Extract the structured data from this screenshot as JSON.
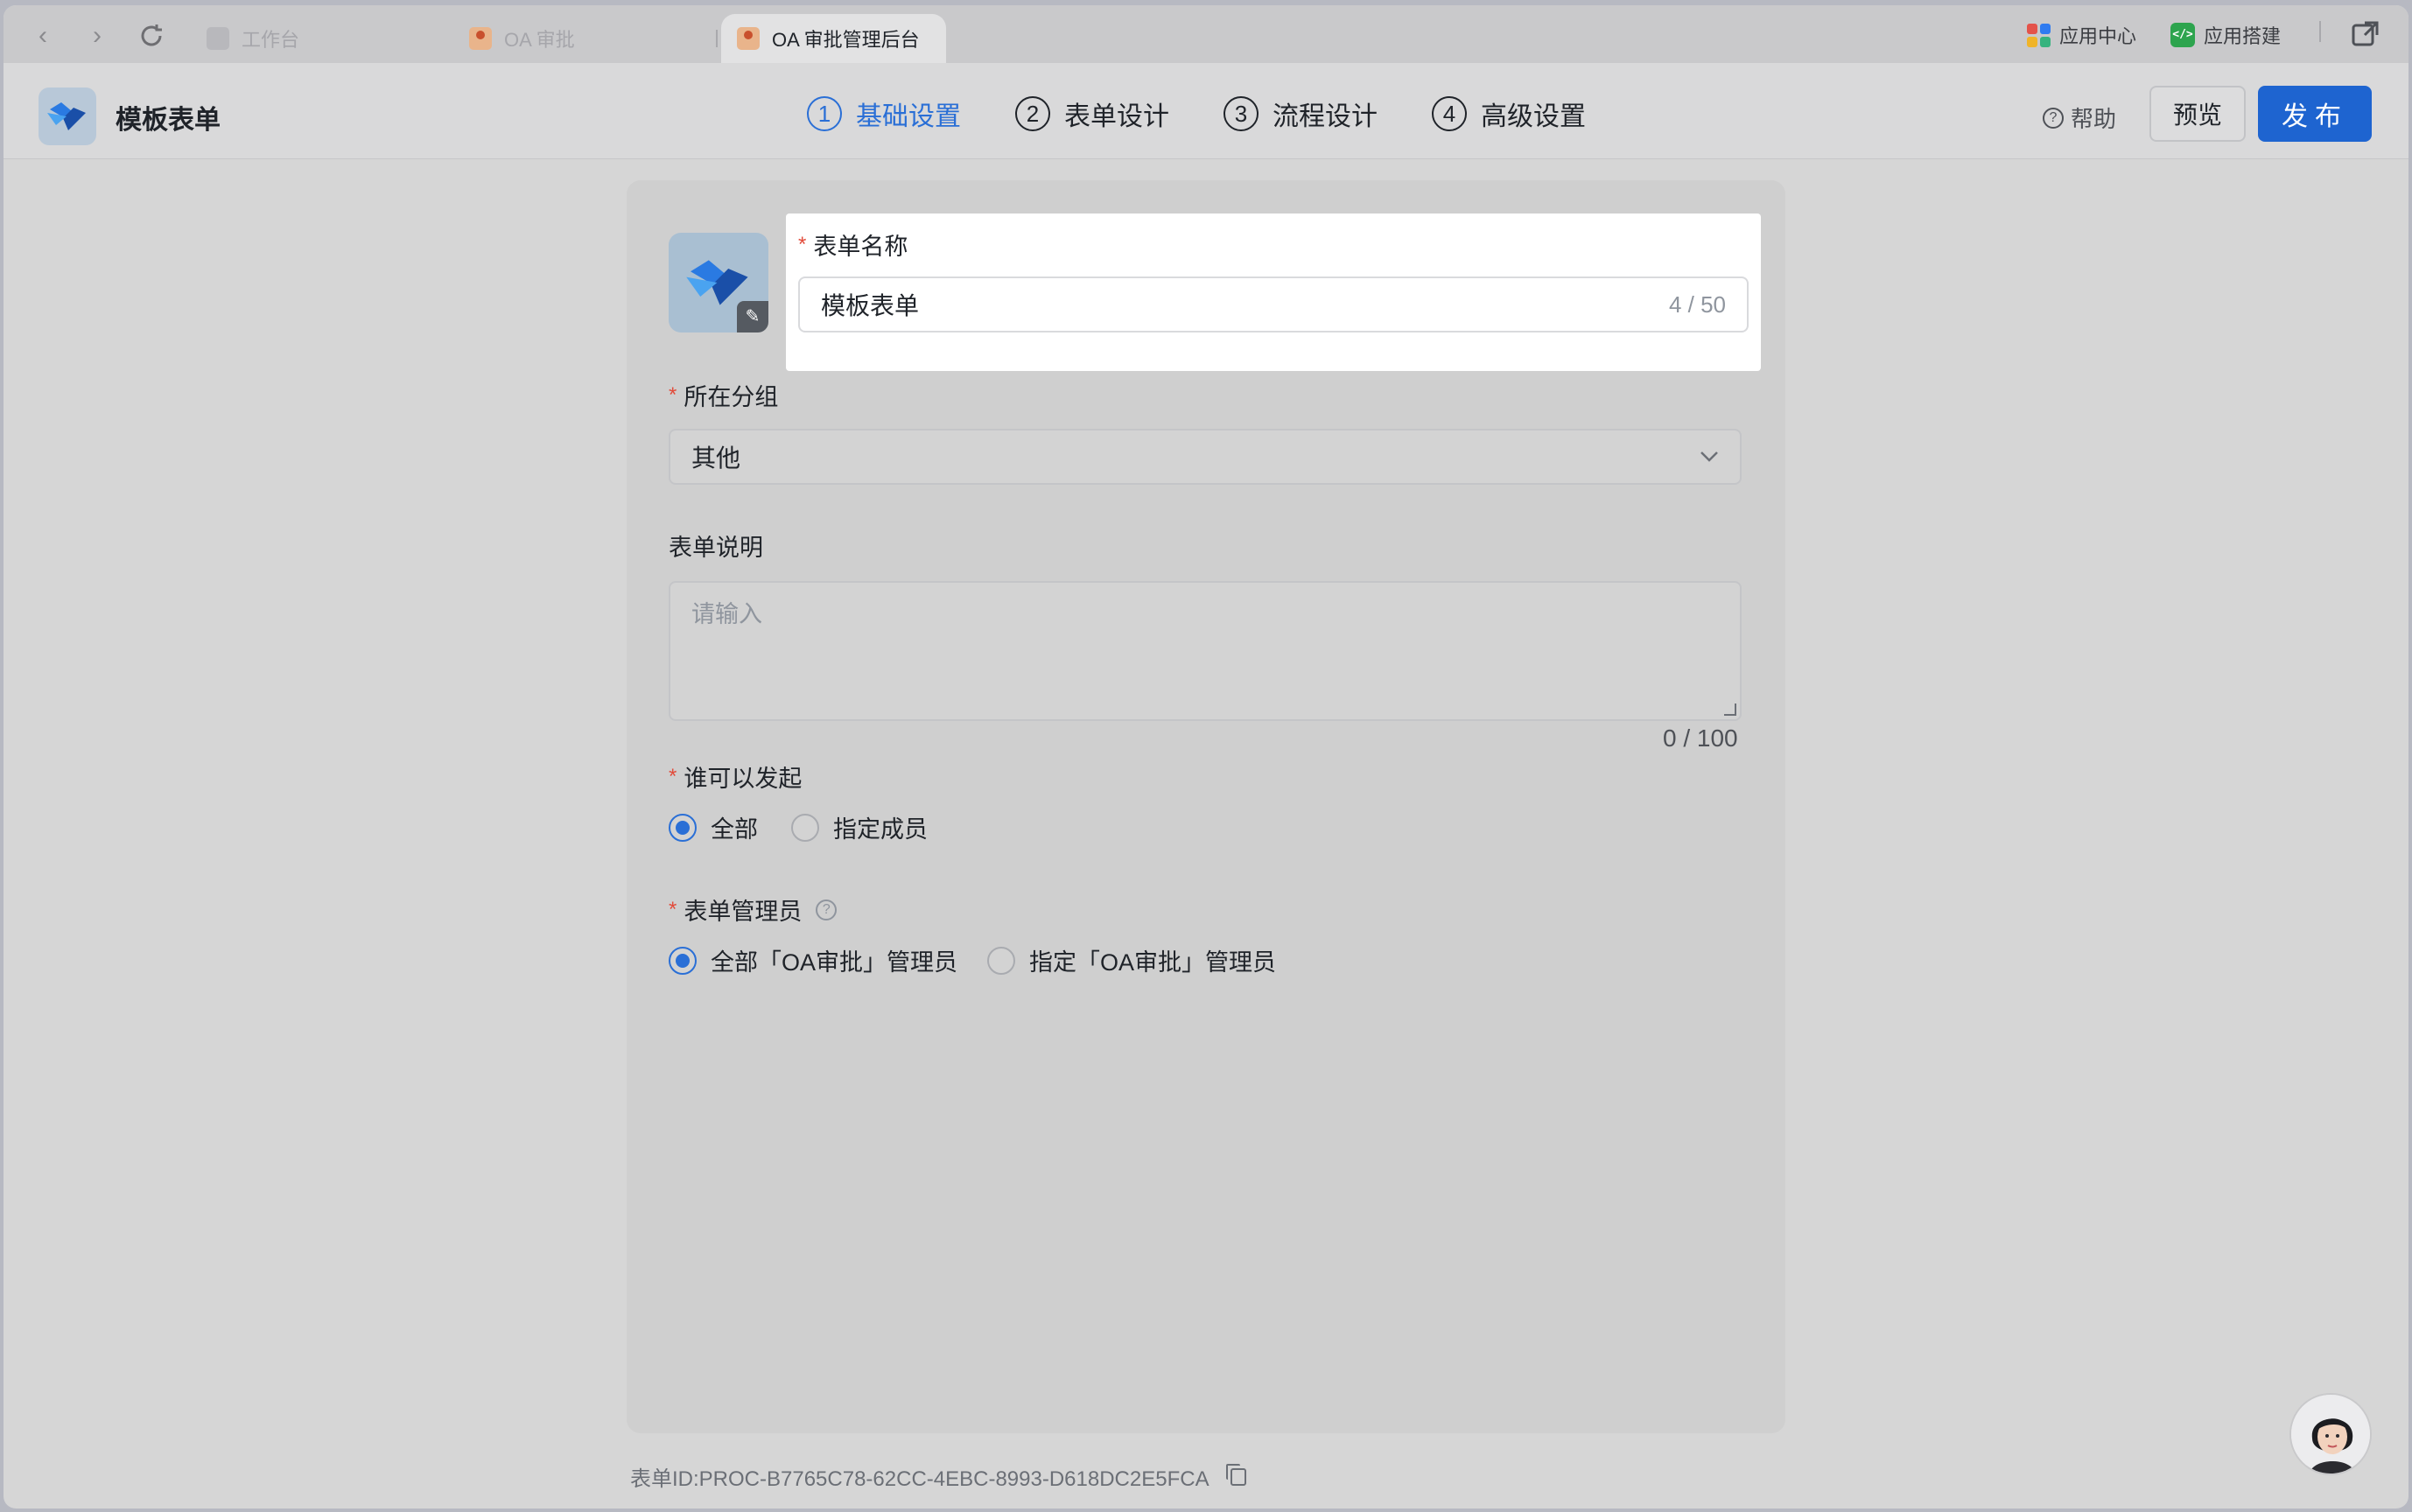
{
  "browser": {
    "tabs": [
      {
        "label": "工作台"
      },
      {
        "label": "OA 审批"
      },
      {
        "label": "OA 审批管理后台"
      }
    ],
    "app_center": "应用中心",
    "app_builder": "应用搭建"
  },
  "header": {
    "title": "模板表单",
    "steps": [
      {
        "num": "1",
        "label": "基础设置"
      },
      {
        "num": "2",
        "label": "表单设计"
      },
      {
        "num": "3",
        "label": "流程设计"
      },
      {
        "num": "4",
        "label": "高级设置"
      }
    ],
    "help": "帮助",
    "preview": "预览",
    "publish": "发布"
  },
  "form": {
    "name_label": "表单名称",
    "name_value": "模板表单",
    "name_counter": "4 / 50",
    "group_label": "所在分组",
    "group_value": "其他",
    "desc_label": "表单说明",
    "desc_placeholder": "请输入",
    "desc_counter": "0 / 100",
    "initiator_label": "谁可以发起",
    "initiator_options": [
      "全部",
      "指定成员"
    ],
    "admin_label": "表单管理员",
    "admin_options": [
      "全部「OA审批」管理员",
      "指定「OA审批」管理员"
    ]
  },
  "footer": {
    "form_id": "表单ID:PROC-B7765C78-62CC-4EBC-8993-D618DC2E5FCA"
  },
  "colors": {
    "accent": "#2a6fd6",
    "publish": "#1e64d0",
    "required": "#e24b3a"
  }
}
